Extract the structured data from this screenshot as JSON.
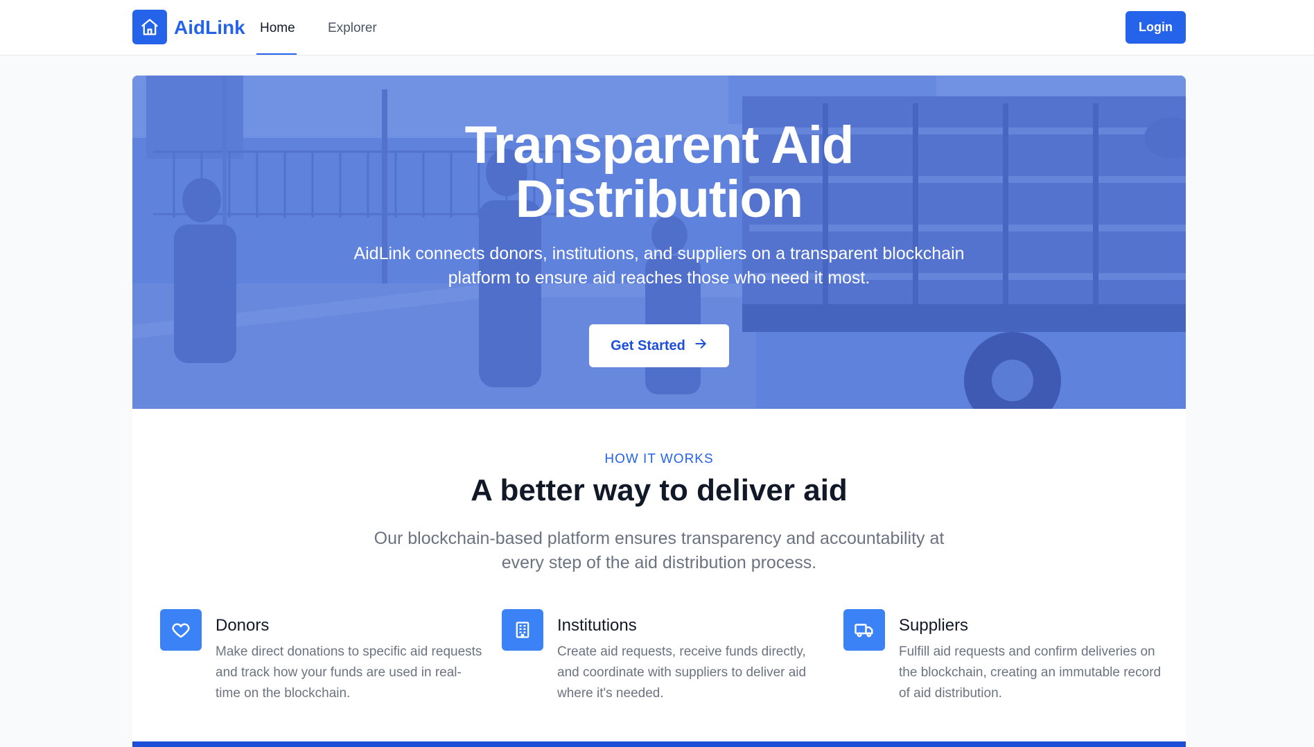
{
  "nav": {
    "brand": "AidLink",
    "links": [
      "Home",
      "Explorer"
    ],
    "active": "Home",
    "login_label": "Login"
  },
  "hero": {
    "title_line1": "Transparent Aid",
    "title_line2": "Distribution",
    "subtitle": "AidLink connects donors, institutions, and suppliers on a transparent blockchain platform to ensure aid reaches those who need it most.",
    "cta_label": "Get Started"
  },
  "how": {
    "eyebrow": "HOW IT WORKS",
    "title": "A better way to deliver aid",
    "description": "Our blockchain-based platform ensures transparency and accountability at every step of the aid distribution process.",
    "features": [
      {
        "icon": "heart-icon",
        "title": "Donors",
        "text": "Make direct donations to specific aid requests and track how your funds are used in real-time on the blockchain."
      },
      {
        "icon": "building-icon",
        "title": "Institutions",
        "text": "Create aid requests, receive funds directly, and coordinate with suppliers to deliver aid where it's needed."
      },
      {
        "icon": "truck-icon",
        "title": "Suppliers",
        "text": "Fulfill aid requests and confirm deliveries on the blockchain, creating an immutable record of aid distribution."
      }
    ]
  },
  "colors": {
    "primary": "#2563eb",
    "primary_dark": "#1d4ed8",
    "feature_icon_bg": "#3b82f6",
    "hero_overlay": "#5d7fd6"
  }
}
